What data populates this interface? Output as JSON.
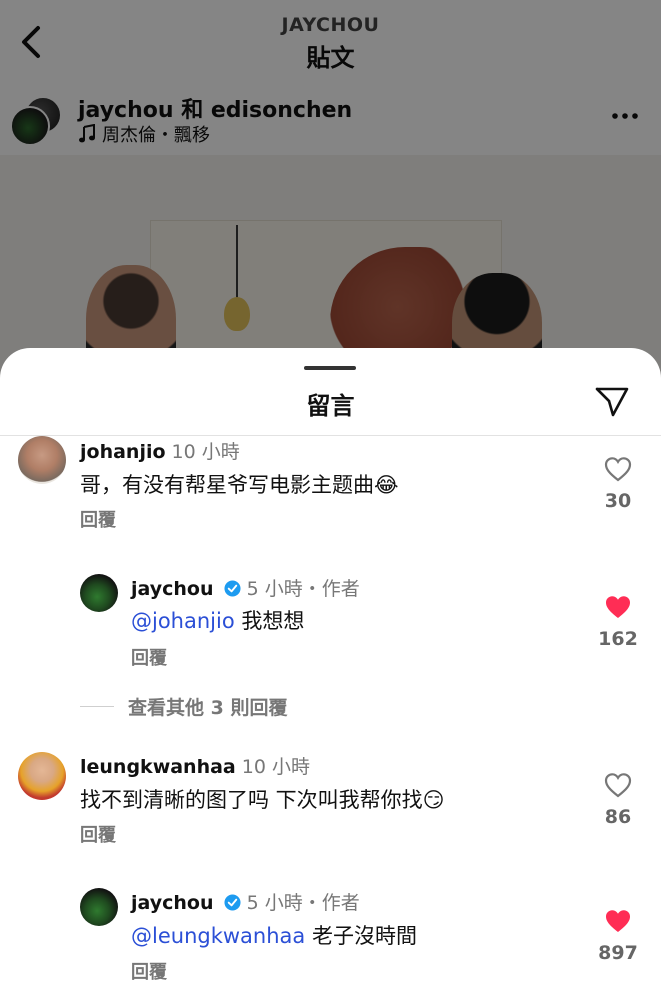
{
  "post_header": {
    "account_handle": "JAYCHOU",
    "title": "貼文",
    "authors": "jaychou 和 edisonchen",
    "music": "周杰倫・飄移"
  },
  "sheet": {
    "title": "留言"
  },
  "comments": [
    {
      "user": "johanjio",
      "time": "10 小時",
      "text": "哥，有没有帮星爷写电影主题曲😂",
      "reply_label": "回覆",
      "likes": "30",
      "liked": false
    },
    {
      "user": "jaychou",
      "verified": true,
      "time": "5 小時・作者",
      "mention": "@johanjio",
      "text": " 我想想",
      "reply_label": "回覆",
      "likes": "162",
      "liked": true
    },
    {
      "user": "leungkwanhaa",
      "time": "10 小時",
      "text": "找不到清晰的图了吗 下次叫我帮你找😏",
      "reply_label": "回覆",
      "likes": "86",
      "liked": false
    },
    {
      "user": "jaychou",
      "verified": true,
      "time": "5 小時・作者",
      "mention": "@leungkwanhaa",
      "text": " 老子沒時間",
      "reply_label": "回覆",
      "likes": "897",
      "liked": true
    }
  ],
  "view_more_replies": "查看其他 3 則回覆",
  "colors": {
    "like_red": "#ff2d55",
    "mention_blue": "#2b4fd6",
    "verified_blue": "#1d9bf0"
  }
}
